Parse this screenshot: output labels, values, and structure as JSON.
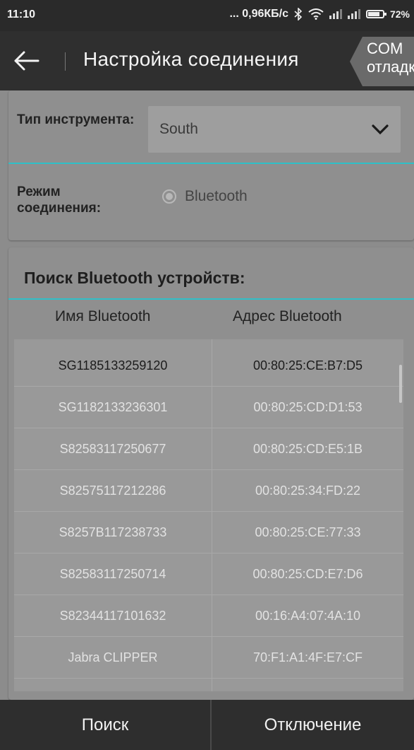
{
  "status_bar": {
    "time": "11:10",
    "network_speed": "... 0,96КБ/с",
    "battery": "72%"
  },
  "toolbar": {
    "title": "Настройка соединения",
    "com_button": "COM отладка"
  },
  "instrument": {
    "type_label": "Тип инструмента:",
    "type_value": "South",
    "mode_label": "Режим соединения:",
    "mode_option": "Bluetooth"
  },
  "search": {
    "title": "Поиск Bluetooth устройств:",
    "col_name": "Имя Bluetooth",
    "col_address": "Адрес Bluetooth",
    "devices": [
      {
        "name": "SG1185133259120",
        "address": "00:80:25:CE:B7:D5"
      },
      {
        "name": "SG1182133236301",
        "address": "00:80:25:CD:D1:53"
      },
      {
        "name": "S82583117250677",
        "address": "00:80:25:CD:E5:1B"
      },
      {
        "name": "S82575117212286",
        "address": "00:80:25:34:FD:22"
      },
      {
        "name": "S8257B117238733",
        "address": "00:80:25:CE:77:33"
      },
      {
        "name": "S82583117250714",
        "address": "00:80:25:CD:E7:D6"
      },
      {
        "name": "S82344117101632",
        "address": "00:16:A4:07:4A:10"
      },
      {
        "name": "Jabra CLIPPER",
        "address": "70:F1:A1:4F:E7:CF"
      }
    ]
  },
  "bottom": {
    "search_button": "Поиск",
    "disconnect_button": "Отключение"
  },
  "colors": {
    "accent": "#2fc0c8",
    "bar": "#2e2e2e"
  }
}
